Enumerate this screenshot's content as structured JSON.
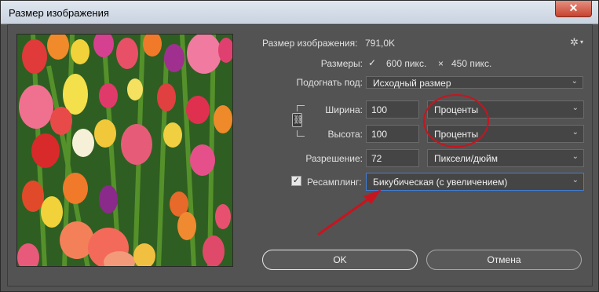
{
  "window": {
    "title": "Размер изображения",
    "close_label": "✕"
  },
  "image_info": {
    "size_label": "Размер изображения:",
    "size_value": "791,0K",
    "dims_label": "Размеры:",
    "width_px": "600 пикс.",
    "times": "×",
    "height_px": "450 пикс."
  },
  "fit_to": {
    "label": "Подогнать под:",
    "value": "Исходный размер"
  },
  "width": {
    "label": "Ширина:",
    "value": "100",
    "unit": "Проценты"
  },
  "height": {
    "label": "Высота:",
    "value": "100",
    "unit": "Проценты"
  },
  "resolution": {
    "label": "Разрешение:",
    "value": "72",
    "unit": "Пиксели/дюйм"
  },
  "resample": {
    "label": "Ресамплинг:",
    "checked": true,
    "value": "Бикубическая (с увеличением)"
  },
  "buttons": {
    "ok": "OK",
    "cancel": "Отмена"
  },
  "annotation_color": "#c8141e"
}
